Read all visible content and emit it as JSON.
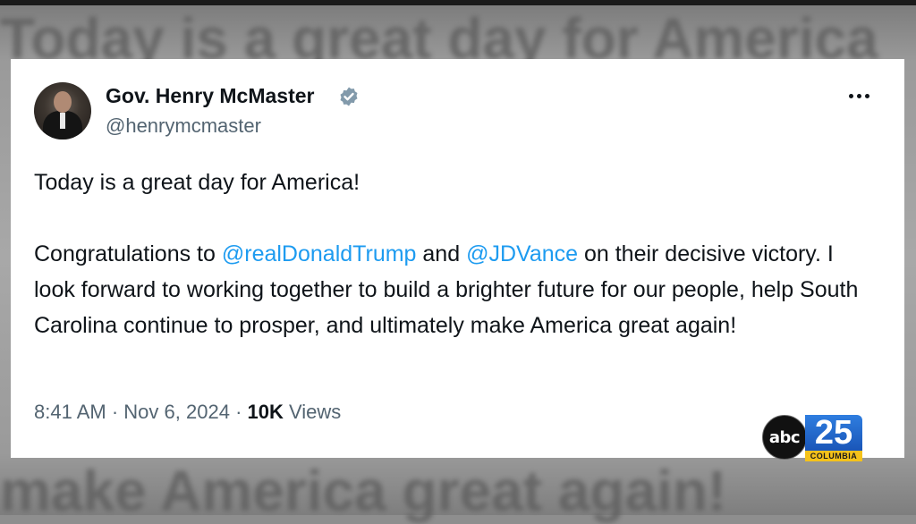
{
  "tweet": {
    "author_name": "Gov. Henry McMaster",
    "handle": "@henrymcmaster",
    "line1": "Today is a great day for America!",
    "para2_prefix": "Congratulations to ",
    "mention1": "@realDonaldTrump",
    "para2_and": " and ",
    "mention2": "@JDVance",
    "para2_rest": " on their decisive victory. I look forward to working together to build a brighter future for our people, help South Carolina continue to prosper, and ultimately make America great again!",
    "time": "8:41 AM",
    "date": "Nov 6, 2024",
    "views_count": "10K",
    "views_label": "Views",
    "separator": "·"
  },
  "background": {
    "top_text": "Today is a great day for America",
    "bottom_text": "make America great again!"
  },
  "logo": {
    "network": "abc",
    "channel": "25",
    "city": "COLUMBIA"
  },
  "colors": {
    "mention": "#1d9bf0",
    "secondary_text": "#536471",
    "primary_text": "#0f1419",
    "verified_badge": "#829aab"
  },
  "icons": {
    "verified": "verified-badge-icon",
    "more": "more-options-icon"
  }
}
